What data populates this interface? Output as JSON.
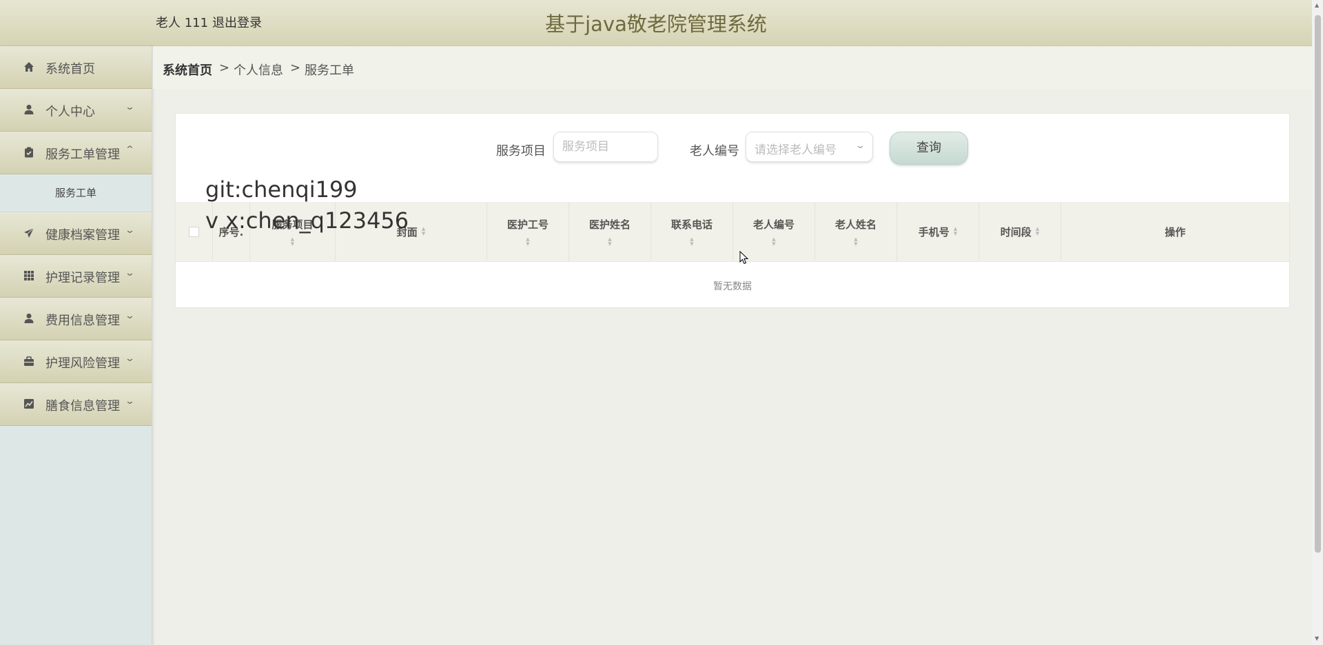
{
  "header": {
    "user_name": "老人 111",
    "logout_label": "退出登录",
    "app_title": "基于java敬老院管理系统"
  },
  "sidebar": {
    "items": [
      {
        "label": "系统首页",
        "icon": "home-icon",
        "expandable": false
      },
      {
        "label": "个人中心",
        "icon": "person-icon",
        "expandable": true,
        "expanded": false
      },
      {
        "label": "服务工单管理",
        "icon": "clipboard-icon",
        "expandable": true,
        "expanded": true
      },
      {
        "label": "健康档案管理",
        "icon": "paper-plane-icon",
        "expandable": true,
        "expanded": false
      },
      {
        "label": "护理记录管理",
        "icon": "grid-icon",
        "expandable": true,
        "expanded": false
      },
      {
        "label": "费用信息管理",
        "icon": "person-icon",
        "expandable": true,
        "expanded": false
      },
      {
        "label": "护理风险管理",
        "icon": "briefcase-icon",
        "expandable": true,
        "expanded": false
      },
      {
        "label": "膳食信息管理",
        "icon": "chart-icon",
        "expandable": true,
        "expanded": false
      }
    ],
    "submenu": {
      "label": "服务工单"
    }
  },
  "breadcrumb": {
    "items": [
      "系统首页",
      "个人信息",
      "服务工单"
    ],
    "separator": ">"
  },
  "search": {
    "service_label": "服务项目",
    "service_placeholder": "服务项目",
    "elder_label": "老人编号",
    "elder_placeholder": "请选择老人编号",
    "query_label": "查询"
  },
  "table": {
    "columns": {
      "index": "序号.",
      "service_item": "服务项目",
      "cover": "封面",
      "staff_id": "医护工号",
      "staff_name": "医护姓名",
      "phone": "联系电话",
      "elder_id": "老人编号",
      "elder_name": "老人姓名",
      "mobile": "手机号",
      "time_slot": "时间段",
      "actions": "操作"
    },
    "empty_text": "暂无数据"
  },
  "watermark": {
    "line1": "git:chenqi199",
    "line2": "v x:chen_q123456"
  },
  "colors": {
    "header_bg": "#dedcc4",
    "sidebar_bg": "#dde8e6",
    "accent_text": "#6e6a3f",
    "button_bg": "#c6d9d2"
  }
}
